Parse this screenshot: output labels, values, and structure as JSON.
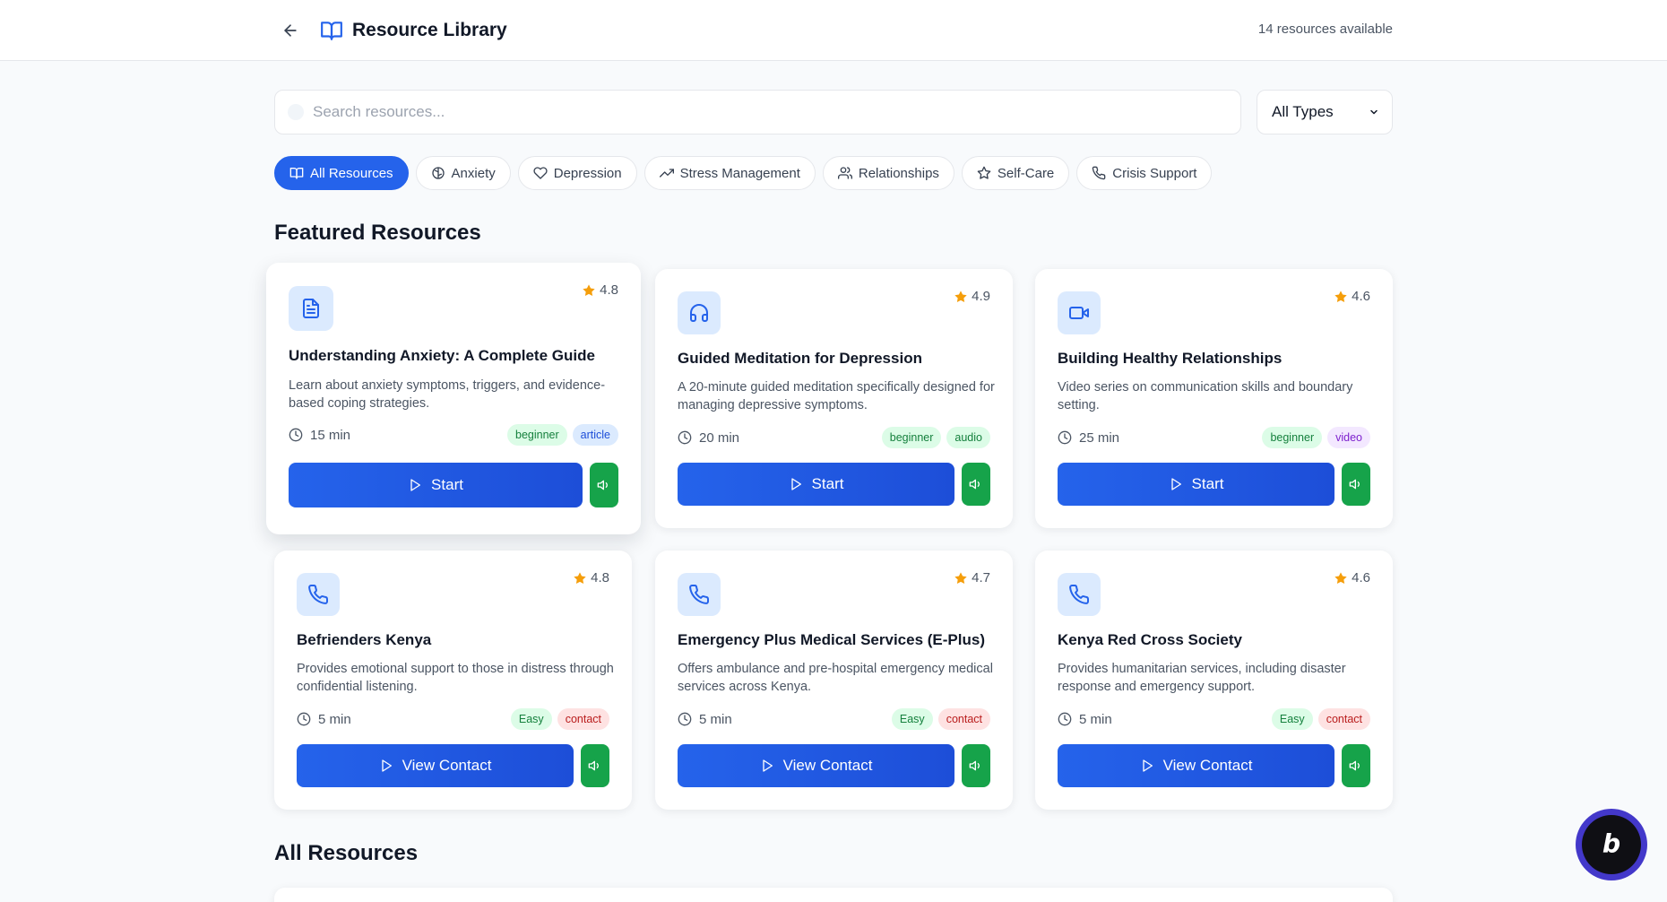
{
  "header": {
    "back_icon": "arrow-left-icon",
    "title_icon": "book-open-icon",
    "title": "Resource Library",
    "resource_count": "14 resources available"
  },
  "search": {
    "placeholder": "Search resources...",
    "value": ""
  },
  "type_filter": {
    "selected": "All Types"
  },
  "categories": [
    {
      "label": "All Resources",
      "icon": "book-open-icon",
      "active": true
    },
    {
      "label": "Anxiety",
      "icon": "brain-icon",
      "active": false
    },
    {
      "label": "Depression",
      "icon": "heart-icon",
      "active": false
    },
    {
      "label": "Stress Management",
      "icon": "trending-up-icon",
      "active": false
    },
    {
      "label": "Relationships",
      "icon": "users-icon",
      "active": false
    },
    {
      "label": "Self-Care",
      "icon": "star-icon",
      "active": false
    },
    {
      "label": "Crisis Support",
      "icon": "phone-icon",
      "active": false
    }
  ],
  "featured": {
    "heading": "Featured Resources",
    "cards": [
      {
        "icon": "document-icon",
        "rating": "4.8",
        "title": "Understanding Anxiety: A Complete Guide",
        "description": "Learn about anxiety symptoms, triggers, and evidence-based coping strategies.",
        "duration": "15 min",
        "level": "beginner",
        "type": "article",
        "action": "Start"
      },
      {
        "icon": "headphones-icon",
        "rating": "4.9",
        "title": "Guided Meditation for Depression",
        "description": "A 20-minute guided meditation specifically designed for managing depressive symptoms.",
        "duration": "20 min",
        "level": "beginner",
        "type": "audio",
        "action": "Start"
      },
      {
        "icon": "video-icon",
        "rating": "4.6",
        "title": "Building Healthy Relationships",
        "description": "Video series on communication skills and boundary setting.",
        "duration": "25 min",
        "level": "beginner",
        "type": "video",
        "action": "Start"
      },
      {
        "icon": "phone-icon",
        "rating": "4.8",
        "title": "Befrienders Kenya",
        "description": "Provides emotional support to those in distress through confidential listening.",
        "duration": "5 min",
        "level": "Easy",
        "type": "contact",
        "action": "View Contact"
      },
      {
        "icon": "phone-icon",
        "rating": "4.7",
        "title": "Emergency Plus Medical Services (E-Plus)",
        "description": "Offers ambulance and pre-hospital emergency medical services across Kenya.",
        "duration": "5 min",
        "level": "Easy",
        "type": "contact",
        "action": "View Contact"
      },
      {
        "icon": "phone-icon",
        "rating": "4.6",
        "title": "Kenya Red Cross Society",
        "description": "Provides humanitarian services, including disaster response and emergency support.",
        "duration": "5 min",
        "level": "Easy",
        "type": "contact",
        "action": "View Contact"
      }
    ]
  },
  "all_resources": {
    "heading": "All Resources"
  },
  "colors": {
    "primary": "#2563eb",
    "audio_button": "#16a34a",
    "star": "#f59e0b",
    "icon_bg": "#dbeafe"
  }
}
